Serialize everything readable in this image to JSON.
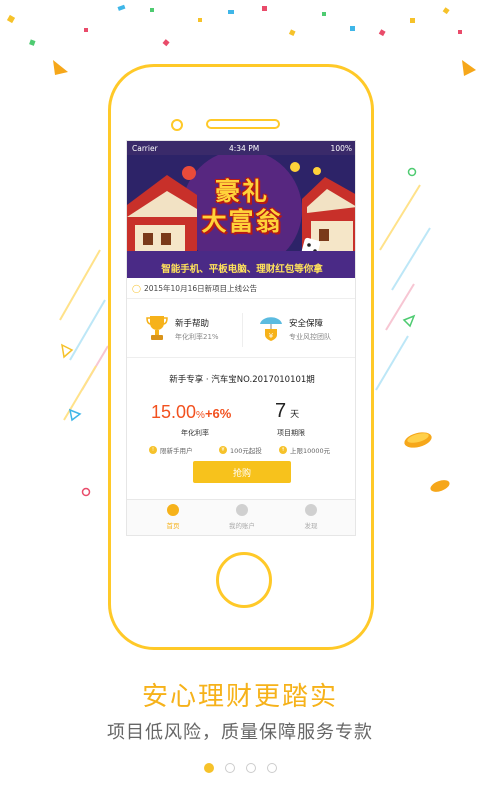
{
  "statusbar": {
    "carrier": "Carrier",
    "time": "4:34 PM",
    "battery": "100%"
  },
  "banner": {
    "title_line1": "豪礼",
    "title_line2": "大富翁",
    "subtitle": "智能手机、平板电脑、理财红包等你拿"
  },
  "notice": {
    "text": "2015年10月16日新项目上线公告"
  },
  "features": [
    {
      "title": "新手帮助",
      "sub": "年化利率21%",
      "icon": "trophy-icon"
    },
    {
      "title": "安全保障",
      "sub": "专业风控团队",
      "icon": "umbrella-shield-icon"
    }
  ],
  "product": {
    "title": "新手专享 · 汽车宝NO.2017010101期",
    "rate": "15.00",
    "rate_pct": "%",
    "bonus": "+6%",
    "rate_label": "年化利率",
    "term": "7",
    "term_unit": "天",
    "term_label": "项目期限",
    "tags": [
      "限新手用户",
      "100元起投",
      "上限10000元"
    ],
    "buy_label": "抢购"
  },
  "tabbar": [
    {
      "label": "首页",
      "icon": "money-bag-icon",
      "active": true
    },
    {
      "label": "我的账户",
      "icon": "account-icon",
      "active": false
    },
    {
      "label": "发现",
      "icon": "compass-icon",
      "active": false
    }
  ],
  "headline": "安心理财更踏实",
  "subline": "项目低风险，质量保障服务专款",
  "pagination": {
    "count": 4,
    "active_index": 0
  },
  "colors": {
    "accent": "#f6b21a",
    "frame": "#ffc928",
    "rate": "#f2511f"
  }
}
